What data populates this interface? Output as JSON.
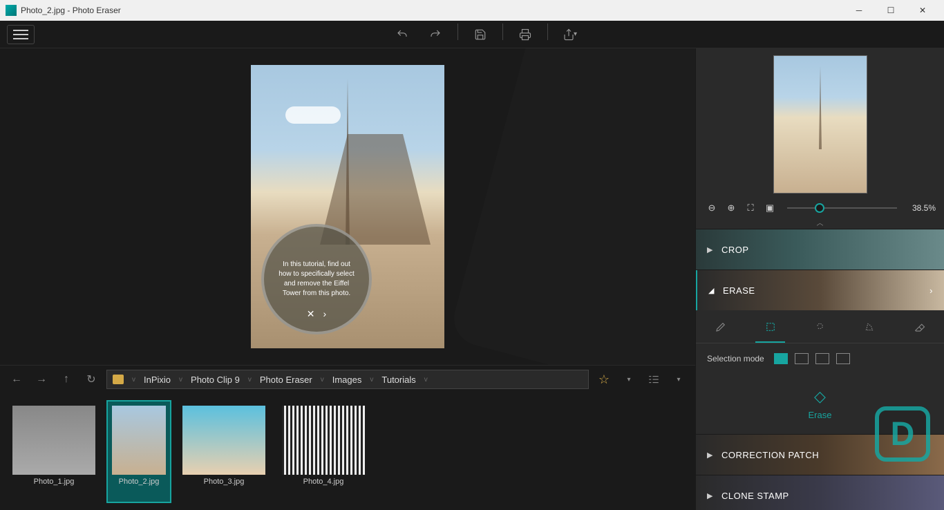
{
  "window": {
    "title": "Photo_2.jpg - Photo Eraser"
  },
  "tutorial": {
    "text": "In this tutorial, find out how to specifically select and remove the Eiffel Tower from this photo."
  },
  "breadcrumb": {
    "items": [
      "InPixio",
      "Photo Clip 9",
      "Photo Eraser",
      "Images",
      "Tutorials"
    ]
  },
  "thumbnails": [
    {
      "label": "Photo_1.jpg"
    },
    {
      "label": "Photo_2.jpg"
    },
    {
      "label": "Photo_3.jpg"
    },
    {
      "label": "Photo_4.jpg"
    }
  ],
  "zoom": {
    "value": "38.5%"
  },
  "panels": {
    "crop": "CROP",
    "erase": "ERASE",
    "correction": "CORRECTION PATCH",
    "clone": "CLONE STAMP"
  },
  "erase_panel": {
    "selection_mode_label": "Selection mode",
    "erase_action": "Erase"
  },
  "logo": "D"
}
